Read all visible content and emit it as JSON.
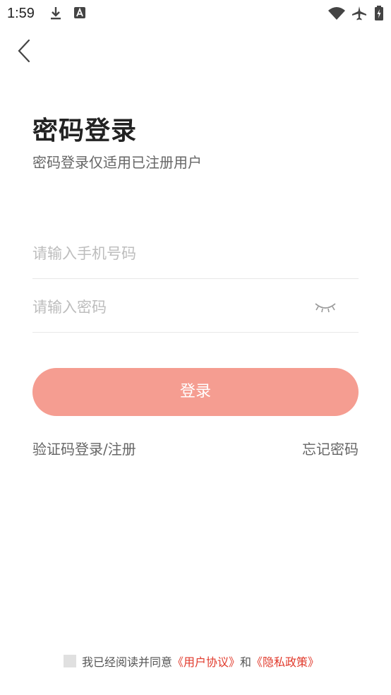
{
  "status_bar": {
    "time": "1:59",
    "icons": [
      "download-icon",
      "font-icon",
      "wifi-icon",
      "airplane-icon",
      "battery-icon"
    ]
  },
  "header": {
    "title": "密码登录",
    "subtitle": "密码登录仅适用已注册用户"
  },
  "form": {
    "phone_placeholder": "请输入手机号码",
    "password_placeholder": "请输入密码",
    "login_label": "登录"
  },
  "links": {
    "sms_login": "验证码登录/注册",
    "forgot_password": "忘记密码"
  },
  "agreement": {
    "prefix": "我已经阅读并同意",
    "user_agreement": "《用户协议》",
    "and": "和",
    "privacy_policy": "《隐私政策》"
  },
  "colors": {
    "button": "#f59d91",
    "link_red": "#e1392b"
  }
}
